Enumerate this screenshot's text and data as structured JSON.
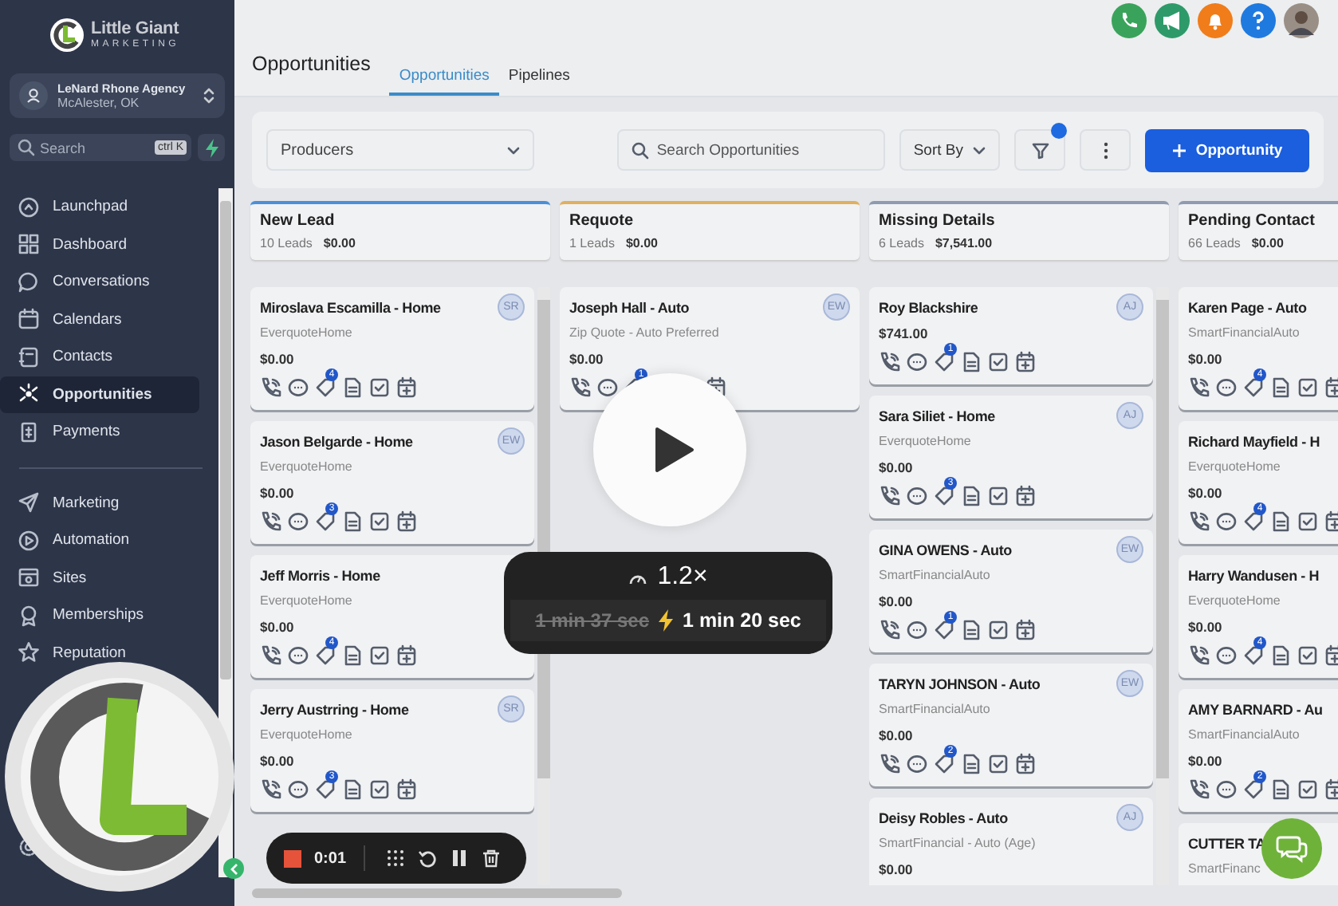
{
  "sidebar": {
    "brand": {
      "name": "Little Giant",
      "tagline": "MARKETING"
    },
    "account": {
      "name": "LeNard Rhone Agency",
      "location": "McAlester, OK"
    },
    "search": {
      "placeholder": "Search",
      "shortcut": "ctrl K"
    },
    "nav": [
      {
        "label": "Launchpad",
        "selected": false
      },
      {
        "label": "Dashboard",
        "selected": false
      },
      {
        "label": "Conversations",
        "selected": false
      },
      {
        "label": "Calendars",
        "selected": false
      },
      {
        "label": "Contacts",
        "selected": false
      },
      {
        "label": "Opportunities",
        "selected": true
      },
      {
        "label": "Payments",
        "selected": false
      }
    ],
    "nav_secondary": [
      {
        "label": "Marketing",
        "selected": false
      },
      {
        "label": "Automation",
        "selected": false
      },
      {
        "label": "Sites",
        "selected": false
      },
      {
        "label": "Memberships",
        "selected": false
      },
      {
        "label": "Reputation",
        "selected": false
      }
    ]
  },
  "header": {
    "title": "Opportunities",
    "tabs": [
      {
        "label": "Opportunities",
        "selected": true
      },
      {
        "label": "Pipelines",
        "selected": false
      }
    ]
  },
  "toolbar": {
    "producers": {
      "placeholder": "Producers"
    },
    "search": {
      "placeholder": "Search Opportunities"
    },
    "sort": "Sort By",
    "filter_active": true,
    "new_button": "Opportunity"
  },
  "columns": [
    {
      "name": "New Lead",
      "leads": "10 Leads",
      "amount": "$0.00",
      "color": "#4a90d9",
      "scrollbar": true,
      "cards": [
        {
          "name": "Miroslava Escamilla - Home",
          "source": "EverquoteHome",
          "amount": "$0.00",
          "avatar": "SR",
          "badge": "4"
        },
        {
          "name": "Jason Belgarde - Home",
          "source": "EverquoteHome",
          "amount": "$0.00",
          "avatar": "EW",
          "badge": "3"
        },
        {
          "name": "Jeff Morris - Home",
          "source": "EverquoteHome",
          "amount": "$0.00",
          "badge": "4"
        },
        {
          "name": "Jerry Austrring - Home",
          "source": "EverquoteHome",
          "amount": "$0.00",
          "avatar": "SR",
          "badge": "3"
        }
      ]
    },
    {
      "name": "Requote",
      "leads": "1 Leads",
      "amount": "$0.00",
      "color": "#e0b060",
      "scrollbar": false,
      "cards": [
        {
          "name": "Joseph Hall - Auto",
          "source": "Zip Quote - Auto Preferred",
          "amount": "$0.00",
          "avatar": "EW",
          "badge": "1"
        }
      ]
    },
    {
      "name": "Missing Details",
      "leads": "6 Leads",
      "amount": "$7,541.00",
      "color": "#8e9bb0",
      "scrollbar": true,
      "cards": [
        {
          "name": "Roy Blackshire",
          "amount": "$741.00",
          "avatar": "AJ",
          "badge": "1"
        },
        {
          "name": "Sara Siliet - Home",
          "source": "EverquoteHome",
          "amount": "$0.00",
          "avatar": "AJ",
          "badge": "3"
        },
        {
          "name": "GINA OWENS - Auto",
          "source": "SmartFinancialAuto",
          "amount": "$0.00",
          "avatar": "EW",
          "badge": "1"
        },
        {
          "name": "TARYN JOHNSON - Auto",
          "source": "SmartFinancialAuto",
          "amount": "$0.00",
          "avatar": "EW",
          "badge": "2"
        },
        {
          "name": "Deisy Robles - Auto",
          "source": "SmartFinancial - Auto (Age)",
          "amount": "$0.00",
          "avatar": "AJ"
        }
      ]
    },
    {
      "name": "Pending Contact",
      "leads": "66 Leads",
      "amount": "$0.00",
      "color": "#8e9bb0",
      "scrollbar": false,
      "cards": [
        {
          "name": "Karen Page - Auto",
          "source": "SmartFinancialAuto",
          "amount": "$0.00",
          "badge": "4"
        },
        {
          "name": "Richard Mayfield - H",
          "source": "EverquoteHome",
          "amount": "$0.00",
          "badge": "4"
        },
        {
          "name": "Harry Wandusen - H",
          "source": "EverquoteHome",
          "amount": "$0.00",
          "badge": "4"
        },
        {
          "name": "AMY BARNARD - Au",
          "source": "SmartFinancialAuto",
          "amount": "$0.00",
          "badge": "2"
        },
        {
          "name": "CUTTER TA",
          "source": "SmartFinanc"
        }
      ]
    }
  ],
  "recorder": {
    "speed": "1.2×",
    "original": "1 min 37 sec",
    "sped_up": "1 min 20 sec",
    "elapsed": "0:01"
  }
}
